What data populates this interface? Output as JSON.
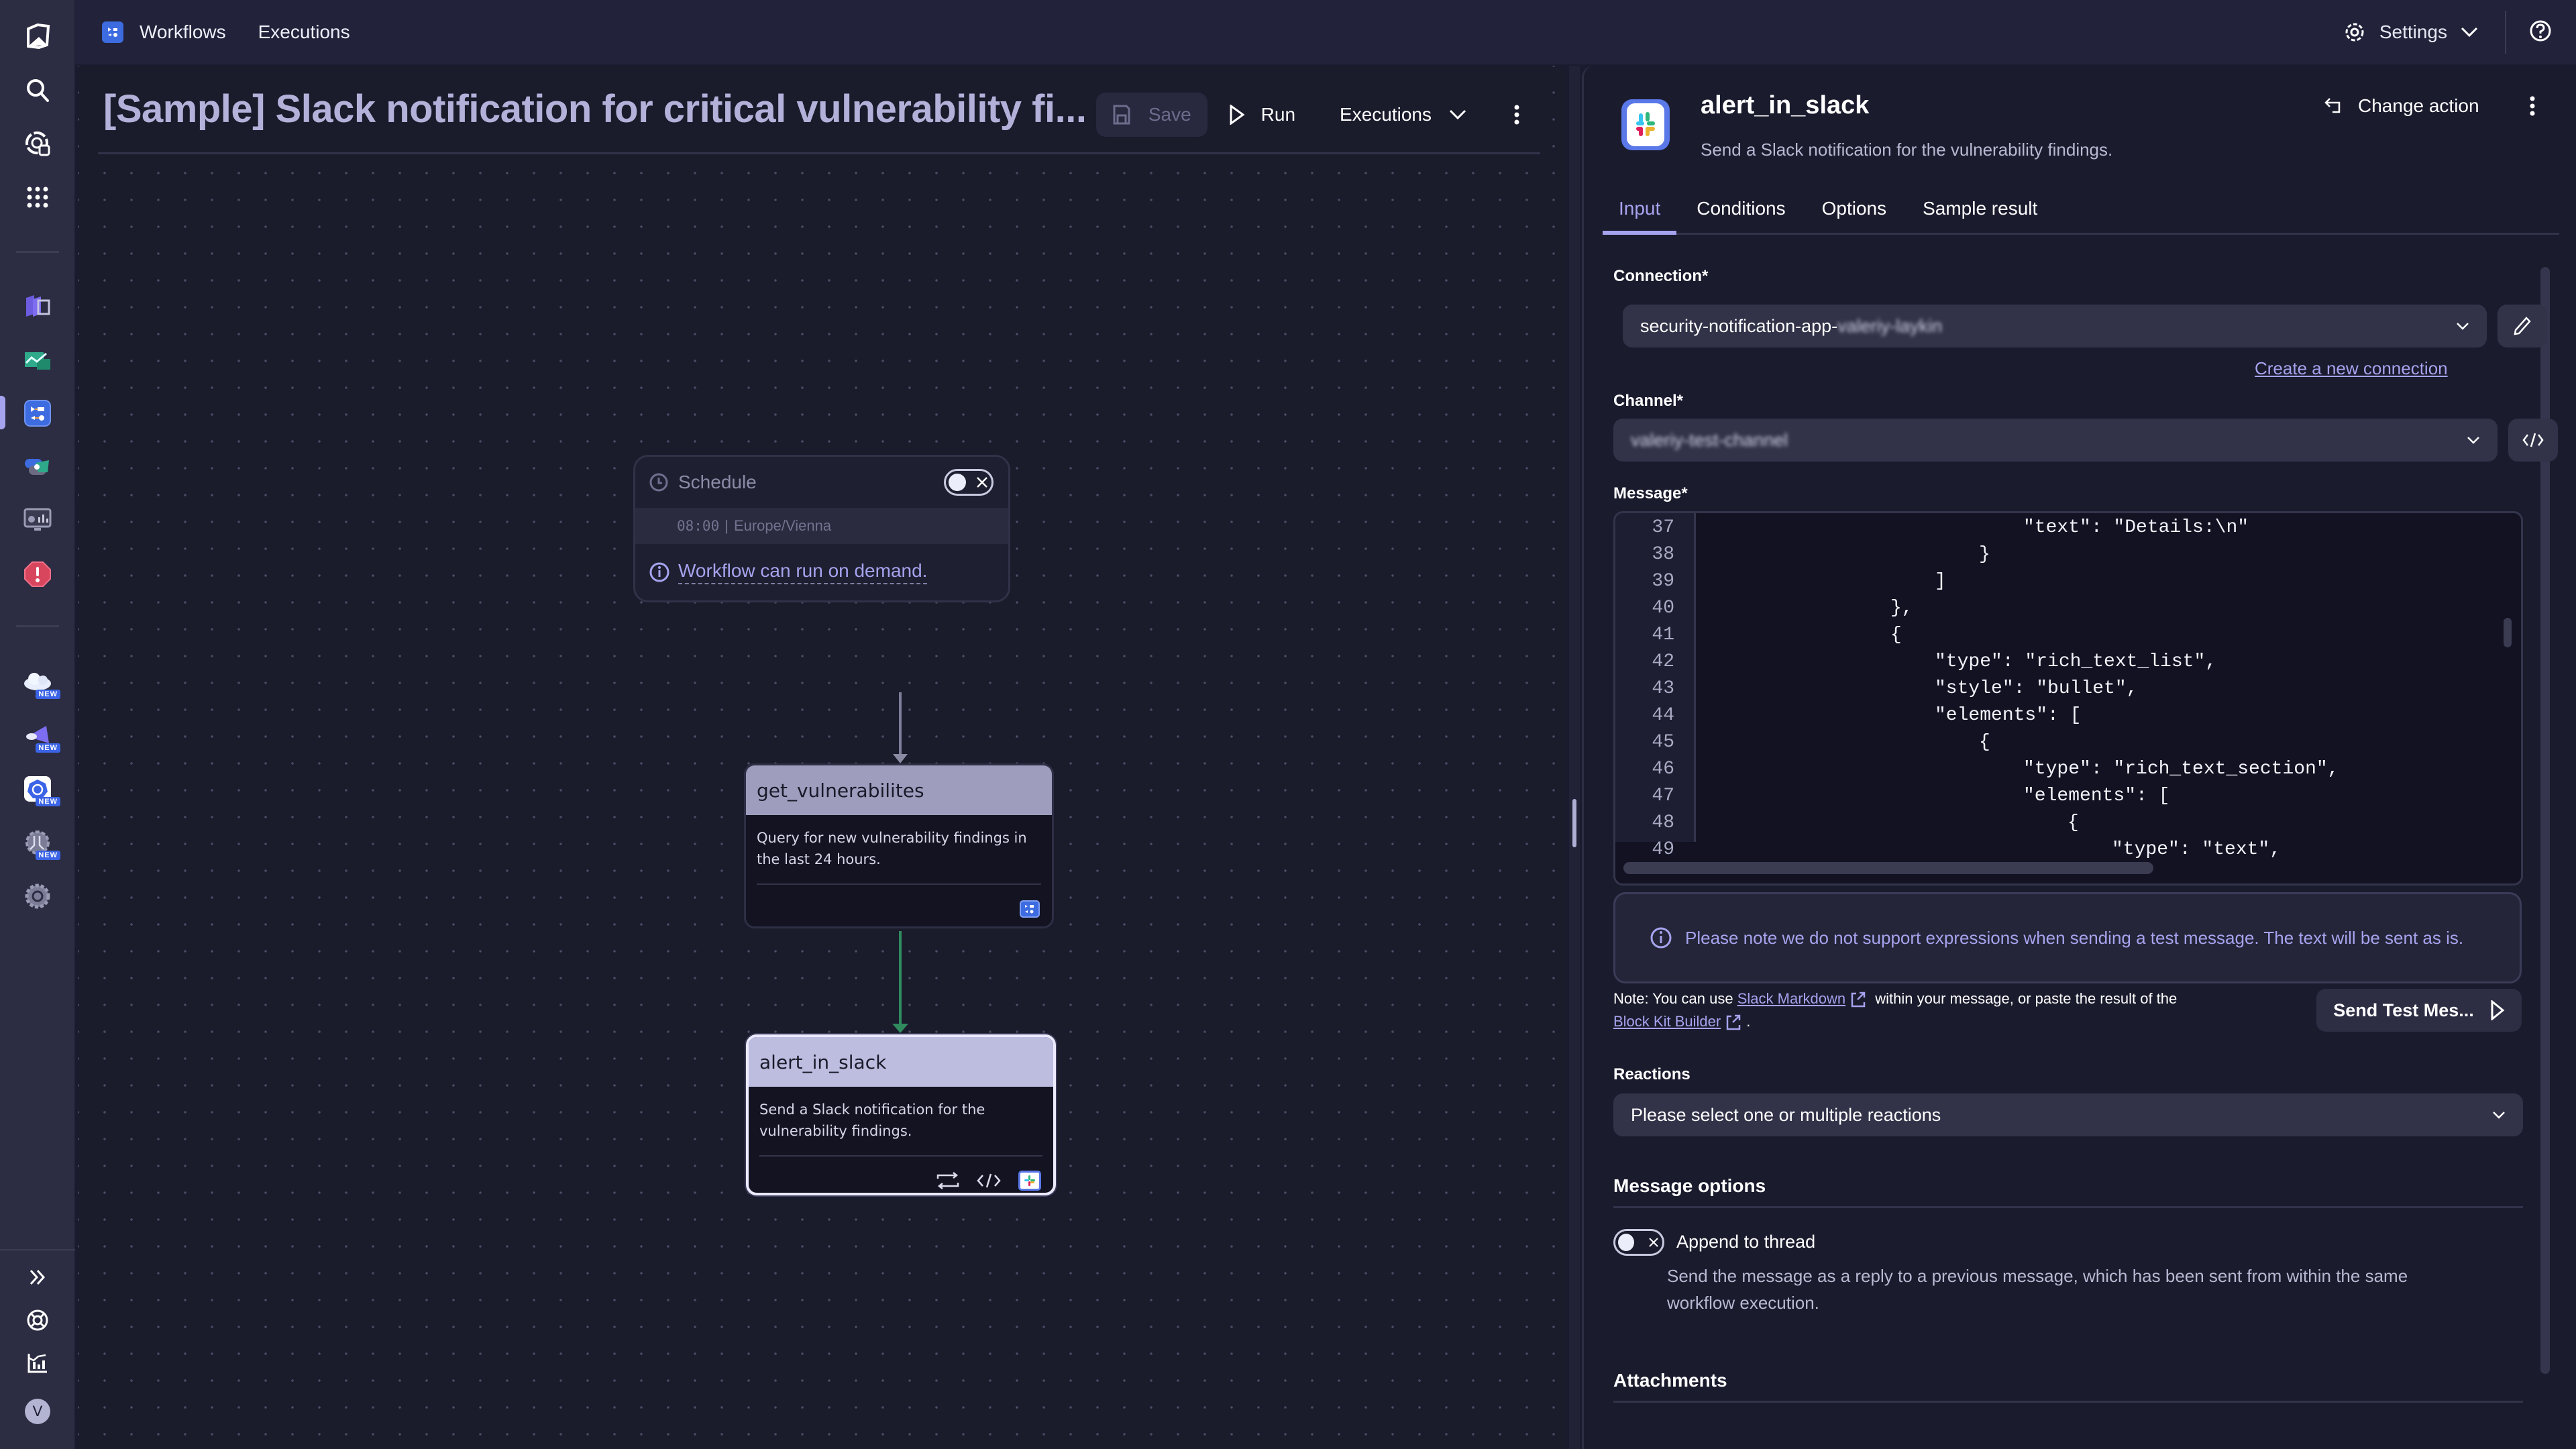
{
  "topbar": {
    "app_name": "Workflows",
    "nav_executions": "Executions",
    "settings_label": "Settings"
  },
  "sidebar": {
    "items": [
      {
        "name": "dynatrace-home",
        "icon": "dynatrace-logo-icon"
      },
      {
        "name": "search",
        "icon": "search-icon"
      },
      {
        "name": "observe-explore",
        "icon": "explore-icon"
      },
      {
        "name": "apps",
        "icon": "apps-grid-icon"
      },
      {
        "name": "infrastructure",
        "icon": "cubes-icon"
      },
      {
        "name": "dashboards",
        "icon": "chart-icon"
      },
      {
        "name": "workflows",
        "icon": "workflows-icon",
        "active": true
      },
      {
        "name": "automations",
        "icon": "automation-icon"
      },
      {
        "name": "monitor",
        "icon": "monitor-icon"
      },
      {
        "name": "problems",
        "icon": "alert-icon"
      },
      {
        "name": "cloud",
        "icon": "cloud-icon",
        "badge": "NEW"
      },
      {
        "name": "services",
        "icon": "services-icon",
        "badge": "NEW"
      },
      {
        "name": "kubernetes",
        "icon": "kubernetes-icon",
        "badge": "NEW"
      },
      {
        "name": "distributed-tracing",
        "icon": "tracing-icon",
        "badge": "NEW"
      },
      {
        "name": "settings-app",
        "icon": "gear-icon"
      }
    ],
    "bottom": [
      {
        "name": "expand",
        "icon": "chevrons-right-icon"
      },
      {
        "name": "support",
        "icon": "lifebuoy-icon"
      },
      {
        "name": "whats-new",
        "icon": "chart-bars-icon"
      }
    ],
    "avatar_initial": "V"
  },
  "canvas": {
    "title": "[Sample] Slack notification for critical vulnerability fi...",
    "save_label": "Save",
    "run_label": "Run",
    "executions_label": "Executions",
    "trigger": {
      "label": "Schedule",
      "time": "08:00",
      "timezone": "Europe/Vienna",
      "info": "Workflow can run on demand.",
      "enabled": false
    },
    "nodes": [
      {
        "name": "get_vulnerabilites",
        "description": "Query for new vulnerability findings in the last 24 hours.",
        "icon": "workflows-icon"
      },
      {
        "name": "alert_in_slack",
        "description": "Send a Slack notification for the vulnerability findings.",
        "icon": "slack-icon",
        "selected": true
      }
    ]
  },
  "panel": {
    "title": "alert_in_slack",
    "description": "Send a Slack notification for the vulnerability findings.",
    "change_action": "Change action",
    "tabs": [
      {
        "label": "Input",
        "active": true
      },
      {
        "label": "Conditions"
      },
      {
        "label": "Options"
      },
      {
        "label": "Sample result"
      }
    ],
    "connection": {
      "label": "Connection*",
      "value_prefix": "security-notification-app-",
      "value_redacted": "valeriy-laykin",
      "create_link": "Create a new connection"
    },
    "channel": {
      "label": "Channel*",
      "value_redacted": "valeriy-test-channel"
    },
    "message": {
      "label": "Message*",
      "lines": [
        {
          "n": "37",
          "indent": 8,
          "text": "\"text\": \"Details:\\n\""
        },
        {
          "n": "38",
          "indent": 7,
          "text": "}"
        },
        {
          "n": "39",
          "indent": 6,
          "text": "]"
        },
        {
          "n": "40",
          "indent": 5,
          "text": "},"
        },
        {
          "n": "41",
          "indent": 5,
          "text": "{"
        },
        {
          "n": "42",
          "indent": 6,
          "text": "\"type\": \"rich_text_list\","
        },
        {
          "n": "43",
          "indent": 6,
          "text": "\"style\": \"bullet\","
        },
        {
          "n": "44",
          "indent": 6,
          "text": "\"elements\": ["
        },
        {
          "n": "45",
          "indent": 7,
          "text": "{"
        },
        {
          "n": "46",
          "indent": 8,
          "text": "\"type\": \"rich_text_section\","
        },
        {
          "n": "47",
          "indent": 8,
          "text": "\"elements\": ["
        },
        {
          "n": "48",
          "indent": 9,
          "text": "{"
        },
        {
          "n": "49",
          "indent": 10,
          "text": "\"type\": \"text\","
        }
      ]
    },
    "notice": "Please note we do not support expressions when sending a test message. The text will be sent as is.",
    "note": {
      "prefix": "Note: You can use",
      "link1": "Slack Markdown",
      "middle": "within your message, or paste the result of the",
      "link2": "Block Kit Builder",
      "suffix": "."
    },
    "send_test": "Send Test Mes...",
    "reactions": {
      "label": "Reactions",
      "placeholder": "Please select one or multiple reactions"
    },
    "message_options": {
      "title": "Message options",
      "append_label": "Append to thread",
      "append_enabled": false,
      "append_desc": "Send the message as a reply to a previous message, which has been sent from within the same workflow execution."
    },
    "attachments_title": "Attachments"
  },
  "colors": {
    "accent": "#a6a3ee",
    "edge_success": "#2f8a5e",
    "background": "#1a1b2e"
  }
}
